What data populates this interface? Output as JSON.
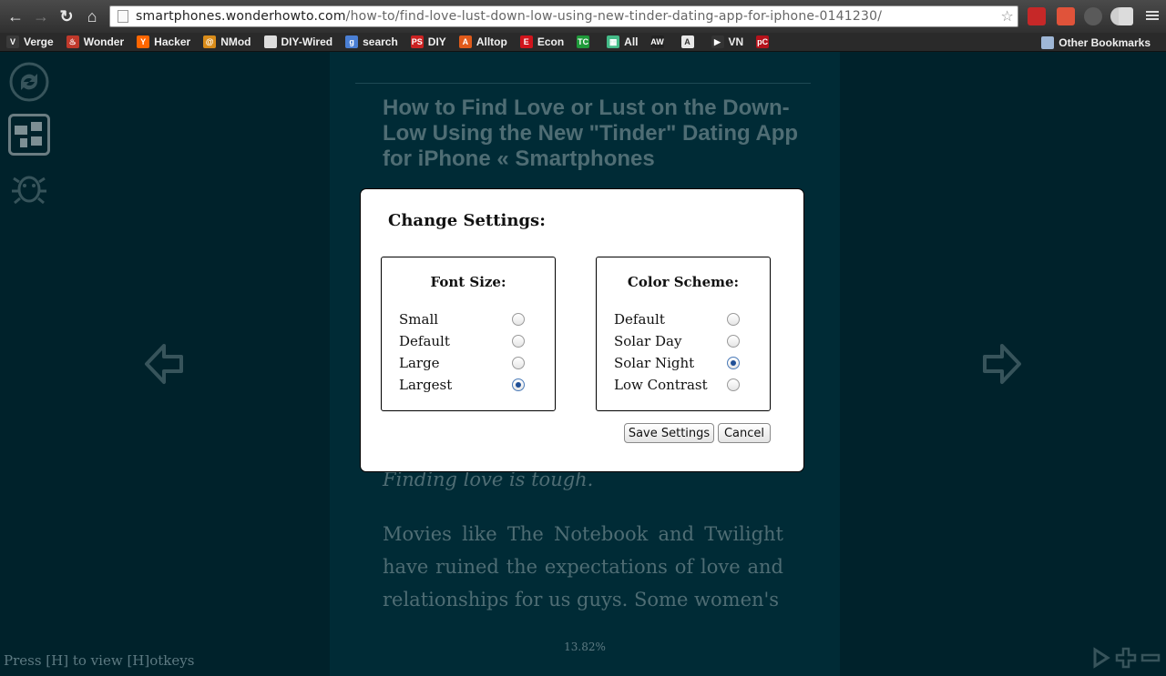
{
  "browser": {
    "url_host": "smartphones.wonderhowto.com",
    "url_path": "/how-to/find-love-lust-down-low-using-new-tinder-dating-app-for-iphone-0141230/",
    "bookmarks": [
      {
        "label": "Verge",
        "icon": "verge-icon",
        "color": "#3a3a3a",
        "glyph": "V"
      },
      {
        "label": "Wonder",
        "icon": "wonder-icon",
        "color": "#c0392b",
        "glyph": "♨"
      },
      {
        "label": "Hacker",
        "icon": "hacker-news-icon",
        "color": "#ff6600",
        "glyph": "Y"
      },
      {
        "label": "NMod",
        "icon": "nmod-icon",
        "color": "#d98c1a",
        "glyph": "@"
      },
      {
        "label": "DIY-Wired",
        "icon": "page-icon",
        "color": "#dddddd",
        "glyph": ""
      },
      {
        "label": "search",
        "icon": "google-icon",
        "color": "#4a7fd4",
        "glyph": "g"
      },
      {
        "label": "DIY",
        "icon": "ps-icon",
        "color": "#cc2222",
        "glyph": "PS"
      },
      {
        "label": "Alltop",
        "icon": "alltop-icon",
        "color": "#e05a1a",
        "glyph": "A"
      },
      {
        "label": "Econ",
        "icon": "economist-icon",
        "color": "#d0141c",
        "glyph": "E"
      },
      {
        "label": "",
        "icon": "techcrunch-icon",
        "color": "#1f9a3a",
        "glyph": "TC"
      },
      {
        "label": "All",
        "icon": "mosaic-icon",
        "color": "#4b8",
        "glyph": "▦"
      },
      {
        "label": "",
        "icon": "aw-icon",
        "color": "#222222",
        "glyph": "AW"
      },
      {
        "label": "",
        "icon": "a-icon",
        "color": "#e8e8e8",
        "glyph": "A"
      },
      {
        "label": "VN",
        "icon": "play-icon",
        "color": "#333333",
        "glyph": "▶"
      },
      {
        "label": "",
        "icon": "pc-icon",
        "color": "#b5121b",
        "glyph": "pC"
      }
    ],
    "other_bookmarks": "Other Bookmarks"
  },
  "article": {
    "title": "How to Find Love or Lust on the Down-Low Using the New \"Tinder\" Dating App for iPhone « Smartphones",
    "lead": "Finding love is tough.",
    "body": "Movies like The Notebook and Twilight have ruined the expectations of love and relationships for us guys. Some women's",
    "progress": "13.82%",
    "hotkeys": "Press [H] to view [H]otkeys"
  },
  "settings": {
    "title": "Change Settings:",
    "font_size": {
      "label": "Font Size:",
      "options": [
        "Small",
        "Default",
        "Large",
        "Largest"
      ],
      "selected": "Largest"
    },
    "color_scheme": {
      "label": "Color Scheme:",
      "options": [
        "Default",
        "Solar Day",
        "Solar Night",
        "Low Contrast"
      ],
      "selected": "Solar Night"
    },
    "save_label": "Save Settings",
    "cancel_label": "Cancel"
  }
}
